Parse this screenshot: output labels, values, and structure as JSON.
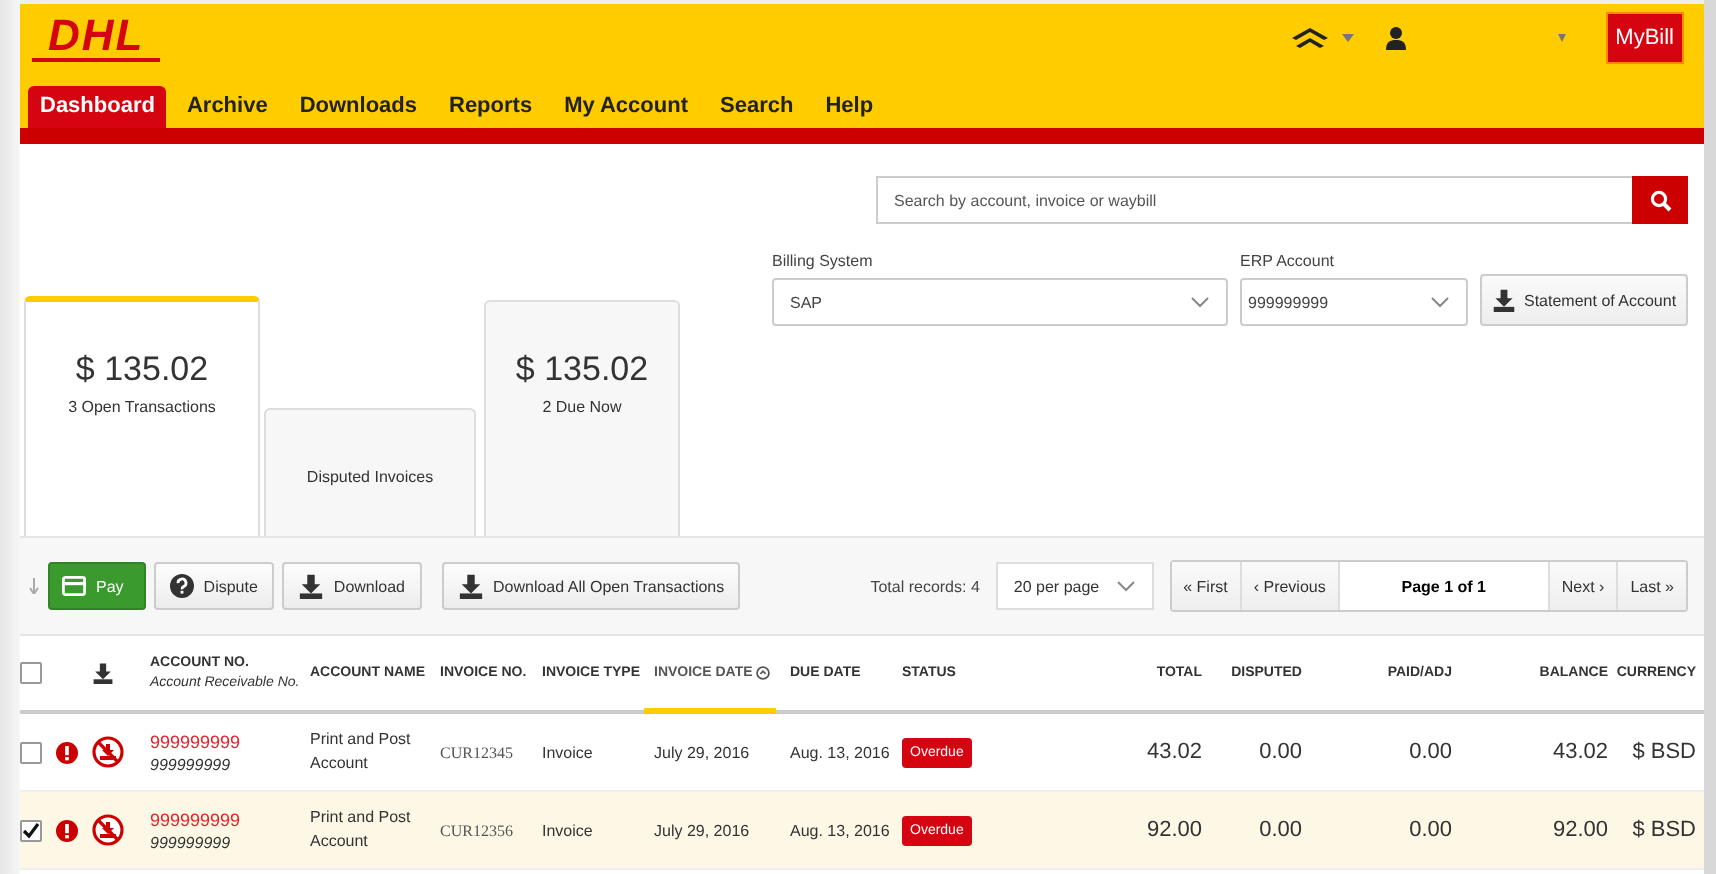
{
  "header": {
    "logo": "DHL",
    "mybill": "MyBill"
  },
  "nav": [
    {
      "label": "Dashboard",
      "selected": true
    },
    {
      "label": "Archive",
      "selected": false
    },
    {
      "label": "Downloads",
      "selected": false
    },
    {
      "label": "Reports",
      "selected": false
    },
    {
      "label": "My Account",
      "selected": false
    },
    {
      "label": "Search",
      "selected": false
    },
    {
      "label": "Help",
      "selected": false
    }
  ],
  "search": {
    "placeholder": "Search by account, invoice or waybill"
  },
  "cards": [
    {
      "amount": "$ 135.02",
      "caption": "3 Open Transactions",
      "selected": true
    },
    {
      "caption": "Disputed Invoices",
      "selected": false
    },
    {
      "amount": "$ 135.02",
      "caption": "2 Due Now",
      "selected": false
    }
  ],
  "billing_system": {
    "label": "Billing System",
    "value": "SAP"
  },
  "erp_account": {
    "label": "ERP Account",
    "value": "999999999"
  },
  "statement_button": "Statement of Account",
  "toolbar": [
    {
      "kind": "pay",
      "label": "Pay"
    },
    {
      "kind": "dispute",
      "label": "Dispute"
    },
    {
      "kind": "download",
      "label": "Download"
    },
    {
      "kind": "download_all",
      "label": "Download All Open Transactions"
    }
  ],
  "total_records": "Total records: 4",
  "per_page": "20 per page",
  "pager": {
    "first": "« First",
    "previous": "‹ Previous",
    "page": "Page 1 of 1",
    "next": "Next ›",
    "last": "Last »"
  },
  "table": {
    "header_checked": false,
    "columns": [
      {
        "label": "ACCOUNT NO.",
        "sublabel": "Account Receivable No.",
        "sorted": false
      },
      {
        "label": "ACCOUNT NAME",
        "sorted": false
      },
      {
        "label": "INVOICE NO.",
        "sorted": false
      },
      {
        "label": "INVOICE TYPE",
        "sorted": false
      },
      {
        "label": "INVOICE DATE",
        "sorted": true
      },
      {
        "label": "DUE DATE",
        "sorted": false
      },
      {
        "label": "STATUS",
        "sorted": false
      },
      {
        "label": "TOTAL",
        "sorted": false
      },
      {
        "label": "DISPUTED",
        "sorted": false
      },
      {
        "label": "PAID/ADJ",
        "sorted": false
      },
      {
        "label": "BALANCE",
        "sorted": false
      },
      {
        "label": "CURRENCY",
        "sorted": false
      }
    ],
    "rows": [
      {
        "checked": false,
        "account_no": "999999999",
        "receivable_no": "999999999",
        "account_name": "Print and Post Account",
        "invoice_no": "CUR12345",
        "invoice_type": "Invoice",
        "invoice_date": "July 29, 2016",
        "due_date": "Aug. 13, 2016",
        "status": "Overdue",
        "total": "43.02",
        "disputed": "0.00",
        "paid_adj": "0.00",
        "balance": "43.02",
        "currency": "$ BSD"
      },
      {
        "checked": true,
        "account_no": "999999999",
        "receivable_no": "999999999",
        "account_name": "Print and Post Account",
        "invoice_no": "CUR12356",
        "invoice_type": "Invoice",
        "invoice_date": "July 29, 2016",
        "due_date": "Aug. 13, 2016",
        "status": "Overdue",
        "total": "92.00",
        "disputed": "0.00",
        "paid_adj": "0.00",
        "balance": "92.00",
        "currency": "$ BSD"
      }
    ]
  }
}
